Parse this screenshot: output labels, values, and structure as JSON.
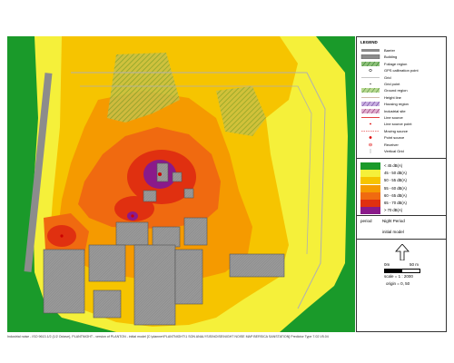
{
  "legend": {
    "title": "LEGEND",
    "symbols": [
      {
        "icon": "barrier-icon",
        "label": "Barrier"
      },
      {
        "icon": "building-icon",
        "label": "Building"
      },
      {
        "icon": "foliage-icon",
        "label": "Foliage region"
      },
      {
        "icon": "gps-point-icon",
        "label": "GPS calibration point"
      },
      {
        "icon": "grid-icon",
        "label": "Grid"
      },
      {
        "icon": "grid-point-icon",
        "label": "Grid point"
      },
      {
        "icon": "ground-region-icon",
        "label": "Ground region"
      },
      {
        "icon": "height-line-icon",
        "label": "Height line"
      },
      {
        "icon": "housing-region-icon",
        "label": "Housing region"
      },
      {
        "icon": "industrial-site-icon",
        "label": "Industrial site"
      },
      {
        "icon": "line-source-icon",
        "label": "Line source"
      },
      {
        "icon": "line-source-point-icon",
        "label": "Line source point"
      },
      {
        "icon": "moving-source-icon",
        "label": "Moving source"
      },
      {
        "icon": "point-source-icon",
        "label": "Point source"
      },
      {
        "icon": "receiver-icon",
        "label": "Receiver"
      },
      {
        "icon": "vertical-grid-icon",
        "label": "Vertical Grid"
      }
    ],
    "bands": [
      {
        "label": "< 45 dB(A)",
        "color": "#1a9a2a"
      },
      {
        "label": "45 - 50 dB(A)",
        "color": "#f5f03a"
      },
      {
        "label": "50 - 55 dB(A)",
        "color": "#f6c400"
      },
      {
        "label": "55 - 60 dB(A)",
        "color": "#f59a00"
      },
      {
        "label": "60 - 65 dB(A)",
        "color": "#f06a10"
      },
      {
        "label": "65 - 70 dB(A)",
        "color": "#e03010"
      },
      {
        "label": "> 70 dB(A)",
        "color": "#8a1a8a"
      }
    ],
    "period_key": "period",
    "period_value": "Night Period",
    "model": "initial model",
    "scale_text": "scale = 1 : 2000",
    "origin_text": "origin = 0, 50",
    "bar_start": "0m",
    "bar_end": "50 m"
  },
  "footer": "Industrial noise - ISO 9613.1/2 (1/2 Octave), PLANTNIGHT - version of PLANTON - initial model [C:\\planner\\PLANTNIGHT\\1 SON ANALYSIS\\NOISE\\NIGHT NOISE MAP BERSICA SANSTATION] Predictor Type 7.02.V5.04",
  "colors": {
    "background": "#22a32a",
    "map_base": "#f5f03a",
    "building": "#8c8c8c"
  }
}
